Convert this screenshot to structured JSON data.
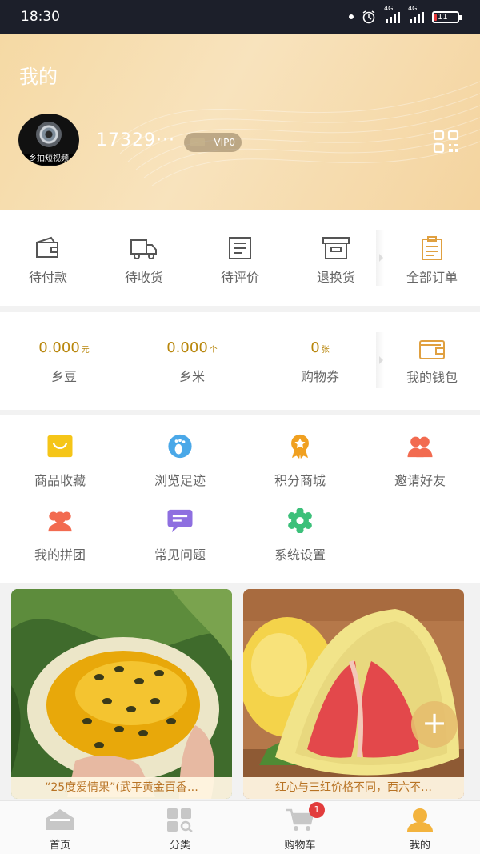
{
  "status_bar": {
    "time": "18:30",
    "network_1": "4G",
    "network_2": "4G",
    "battery": "11",
    "battery_level": 0.11
  },
  "header": {
    "title": "我的",
    "avatar_caption": "乡拍短视频",
    "phone": "17329···",
    "vip": "VIP0",
    "qr_icon": "qr-code-icon"
  },
  "orders": [
    {
      "label": "待付款",
      "icon": "wallet-icon"
    },
    {
      "label": "待收货",
      "icon": "truck-icon"
    },
    {
      "label": "待评价",
      "icon": "review-icon"
    },
    {
      "label": "退换货",
      "icon": "return-box-icon"
    },
    {
      "label": "全部订单",
      "icon": "clipboard-icon"
    }
  ],
  "wallet": [
    {
      "value": "0.000",
      "unit": "元",
      "label": "乡豆"
    },
    {
      "value": "0.000",
      "unit": "个",
      "label": "乡米"
    },
    {
      "value": "0",
      "unit": "张",
      "label": "购物券"
    },
    {
      "label": "我的钱包",
      "icon": "wallet-icon"
    }
  ],
  "tools": [
    {
      "label": "商品收藏",
      "icon": "shopping-bag-icon",
      "color": "#f5c518"
    },
    {
      "label": "浏览足迹",
      "icon": "footprint-icon",
      "color": "#4aa8e8"
    },
    {
      "label": "积分商城",
      "icon": "medal-icon",
      "color": "#f0a020"
    },
    {
      "label": "邀请好友",
      "icon": "users-icon",
      "color": "#f26b50"
    },
    {
      "label": "我的拼团",
      "icon": "group-icon",
      "color": "#f26b50"
    },
    {
      "label": "常见问题",
      "icon": "chat-icon",
      "color": "#8e6fe0"
    },
    {
      "label": "系统设置",
      "icon": "gear-icon",
      "color": "#3cc07a"
    }
  ],
  "products": [
    {
      "caption": "“25度爱情果”(武平黄金百香…"
    },
    {
      "caption": "红心与三红价格不同，西六不…"
    }
  ],
  "add_button": "+",
  "tabs": [
    {
      "label": "首页",
      "icon": "home-icon"
    },
    {
      "label": "分类",
      "icon": "category-icon"
    },
    {
      "label": "购物车",
      "icon": "cart-icon",
      "badge": "1"
    },
    {
      "label": "我的",
      "icon": "profile-icon"
    }
  ],
  "colors": {
    "accent": "#f0c070",
    "price": "#b8860b",
    "caption": "#b87324",
    "badge": "#e23c3c"
  }
}
